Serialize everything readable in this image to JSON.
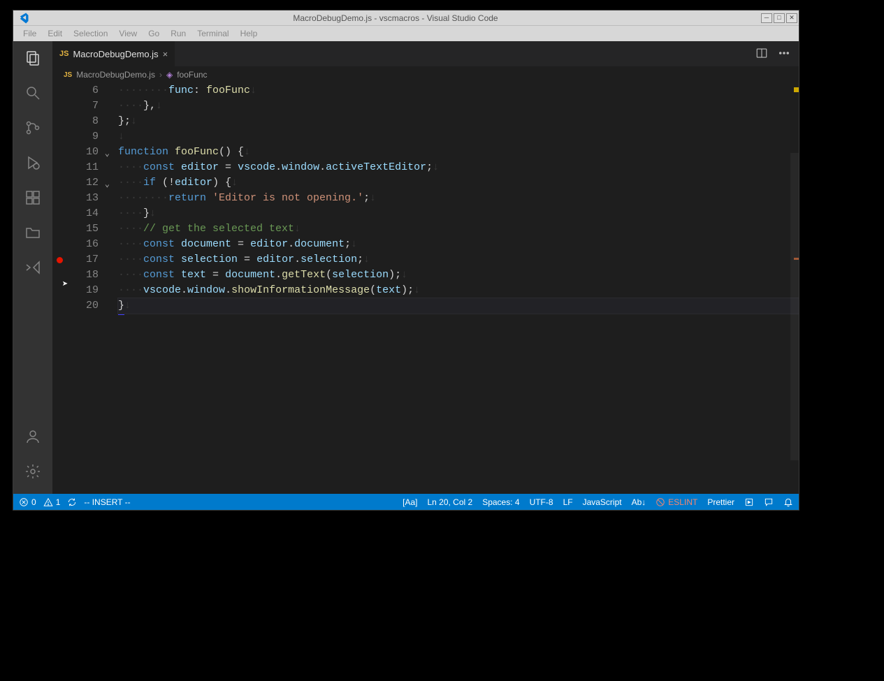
{
  "titlebar": {
    "title": "MacroDebugDemo.js - vscmacros - Visual Studio Code"
  },
  "menu": {
    "items": [
      "File",
      "Edit",
      "Selection",
      "View",
      "Go",
      "Run",
      "Terminal",
      "Help"
    ]
  },
  "tab": {
    "icon": "JS",
    "name": "MacroDebugDemo.js"
  },
  "breadcrumb": {
    "file": "MacroDebugDemo.js",
    "symbol": "fooFunc"
  },
  "gutter": {
    "start": 6,
    "end": 20,
    "folds": [
      10,
      12
    ],
    "breakpoints": [
      17
    ]
  },
  "code": {
    "6": {
      "ws": "········",
      "tokens": [
        {
          "t": "v",
          "x": "func"
        },
        {
          "t": "p",
          "x": ": "
        },
        {
          "t": "fn",
          "x": "fooFunc"
        }
      ]
    },
    "7": {
      "ws": "····",
      "tokens": [
        {
          "t": "p",
          "x": "},"
        }
      ]
    },
    "8": {
      "ws": "",
      "tokens": [
        {
          "t": "p",
          "x": "};"
        }
      ]
    },
    "9": {
      "ws": "",
      "tokens": []
    },
    "10": {
      "ws": "",
      "tokens": [
        {
          "t": "k",
          "x": "function "
        },
        {
          "t": "fn",
          "x": "fooFunc"
        },
        {
          "t": "p",
          "x": "() "
        },
        {
          "t": "p",
          "x": "{"
        }
      ]
    },
    "11": {
      "ws": "····",
      "tokens": [
        {
          "t": "k",
          "x": "const "
        },
        {
          "t": "v",
          "x": "editor"
        },
        {
          "t": "p",
          "x": " = "
        },
        {
          "t": "v",
          "x": "vscode"
        },
        {
          "t": "p",
          "x": "."
        },
        {
          "t": "v",
          "x": "window"
        },
        {
          "t": "p",
          "x": "."
        },
        {
          "t": "v",
          "x": "activeTextEditor"
        },
        {
          "t": "p",
          "x": ";"
        }
      ]
    },
    "12": {
      "ws": "····",
      "tokens": [
        {
          "t": "k",
          "x": "if"
        },
        {
          "t": "p",
          "x": " (!"
        },
        {
          "t": "v",
          "x": "editor"
        },
        {
          "t": "p",
          "x": ") {"
        }
      ]
    },
    "13": {
      "ws": "········",
      "tokens": [
        {
          "t": "k",
          "x": "return "
        },
        {
          "t": "s",
          "x": "'Editor is not opening.'"
        },
        {
          "t": "p",
          "x": ";"
        }
      ]
    },
    "14": {
      "ws": "····",
      "tokens": [
        {
          "t": "p",
          "x": "}"
        }
      ]
    },
    "15": {
      "ws": "····",
      "tokens": [
        {
          "t": "c",
          "x": "// get the selected text"
        }
      ]
    },
    "16": {
      "ws": "····",
      "tokens": [
        {
          "t": "k",
          "x": "const "
        },
        {
          "t": "v",
          "x": "document"
        },
        {
          "t": "p",
          "x": " = "
        },
        {
          "t": "v",
          "x": "editor"
        },
        {
          "t": "p",
          "x": "."
        },
        {
          "t": "v",
          "x": "document"
        },
        {
          "t": "p",
          "x": ";"
        }
      ]
    },
    "17": {
      "ws": "····",
      "tokens": [
        {
          "t": "k",
          "x": "const "
        },
        {
          "t": "v",
          "x": "selection"
        },
        {
          "t": "p",
          "x": " = "
        },
        {
          "t": "v",
          "x": "editor"
        },
        {
          "t": "p",
          "x": "."
        },
        {
          "t": "v",
          "x": "selection"
        },
        {
          "t": "p",
          "x": ";"
        }
      ]
    },
    "18": {
      "ws": "····",
      "tokens": [
        {
          "t": "k",
          "x": "const "
        },
        {
          "t": "v",
          "x": "text"
        },
        {
          "t": "p",
          "x": " = "
        },
        {
          "t": "v",
          "x": "document"
        },
        {
          "t": "p",
          "x": "."
        },
        {
          "t": "fn",
          "x": "getText"
        },
        {
          "t": "p",
          "x": "("
        },
        {
          "t": "v",
          "x": "selection"
        },
        {
          "t": "p",
          "x": ");"
        }
      ]
    },
    "19": {
      "ws": "····",
      "tokens": [
        {
          "t": "v",
          "x": "vscode"
        },
        {
          "t": "p",
          "x": "."
        },
        {
          "t": "v",
          "x": "window"
        },
        {
          "t": "p",
          "x": "."
        },
        {
          "t": "fn",
          "x": "showInformationMessage"
        },
        {
          "t": "p",
          "x": "("
        },
        {
          "t": "v",
          "x": "text"
        },
        {
          "t": "p",
          "x": ");"
        }
      ]
    },
    "20": {
      "ws": "",
      "tokens": [
        {
          "t": "p",
          "x": "}"
        }
      ],
      "current": true
    }
  },
  "status": {
    "errors": "0",
    "warnings": "1",
    "vim": "-- INSERT --",
    "case": "[Aa]",
    "pos": "Ln 20, Col 2",
    "spaces": "Spaces: 4",
    "enc": "UTF-8",
    "eol": "LF",
    "lang": "JavaScript",
    "ab": "Ab↓",
    "eslint": "ESLINT",
    "prettier": "Prettier"
  }
}
